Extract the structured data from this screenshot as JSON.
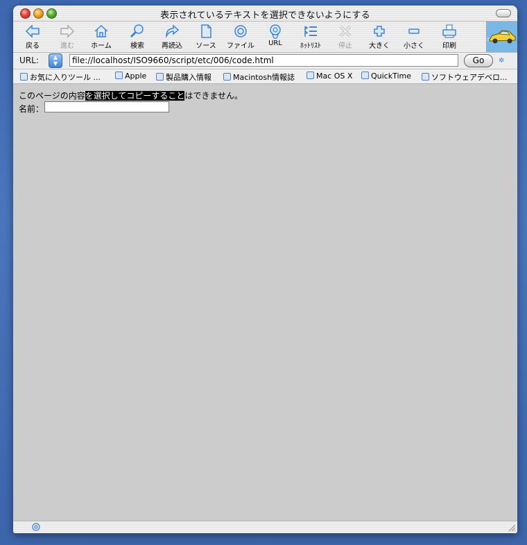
{
  "window": {
    "title": "表示されているテキストを選択できないようにする"
  },
  "toolbar": {
    "buttons": [
      {
        "label": "戻る",
        "icon": "back-arrow-icon",
        "enabled": true
      },
      {
        "label": "進む",
        "icon": "forward-arrow-icon",
        "enabled": false
      },
      {
        "label": "ホーム",
        "icon": "home-icon",
        "enabled": true
      },
      {
        "label": "検索",
        "icon": "search-icon",
        "enabled": true
      },
      {
        "label": "再読込",
        "icon": "reload-icon",
        "enabled": true
      },
      {
        "label": "ソース",
        "icon": "source-document-icon",
        "enabled": true
      },
      {
        "label": "ファイル",
        "icon": "file-target-icon",
        "enabled": true
      },
      {
        "label": "URL",
        "icon": "url-globe-icon",
        "enabled": true
      },
      {
        "label": "ﾎｯﾄﾘｽﾄ",
        "icon": "hotlist-icon",
        "enabled": true
      },
      {
        "label": "停止",
        "icon": "stop-icon",
        "enabled": false
      },
      {
        "label": "大きく",
        "icon": "plus-icon",
        "enabled": true
      },
      {
        "label": "小さく",
        "icon": "minus-icon",
        "enabled": true
      },
      {
        "label": "印刷",
        "icon": "print-icon",
        "enabled": true
      }
    ]
  },
  "urlbar": {
    "label": "URL:",
    "value": "file://localhost/ISO9660/script/etc/006/code.html",
    "go_label": "Go"
  },
  "favorites": [
    "お気に入りツール ...",
    "Apple",
    "製品購入情報",
    "Macintosh情報誌",
    "Mac OS X",
    "QuickTime",
    "ソフトウェアデベロ..."
  ],
  "page": {
    "text_before": "このページの内容",
    "text_selected": "を選択してコピーすること",
    "text_after": "はできません。",
    "name_label": "名前：",
    "name_value": ""
  },
  "colors": {
    "accent": "#3d84d6",
    "content_bg": "#cccccc",
    "selection_bg": "#000000",
    "desktop": "#4a76bd"
  }
}
